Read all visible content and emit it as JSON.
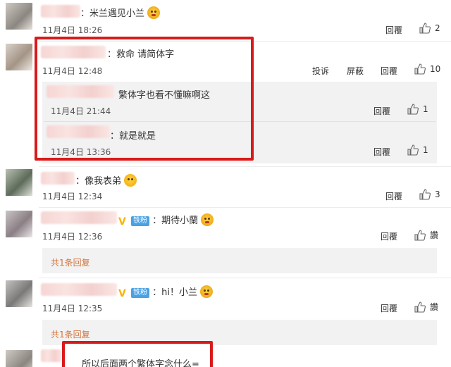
{
  "comments": [
    {
      "suffix": "：米兰遇见小兰",
      "time": "11月4日 18:26",
      "reply": "回覆",
      "likes": "2"
    },
    {
      "suffix": "：救命 请简体字",
      "time": "11月4日 12:48",
      "report": "投诉",
      "block": "屏蔽",
      "reply": "回覆",
      "likes": "10",
      "subs": [
        {
          "suffix": "繁体字也看不懂嘛啊这",
          "time": "11月4日 21:44",
          "reply": "回覆",
          "likes": "1"
        },
        {
          "suffix": "：就是就是",
          "time": "11月4日 13:36",
          "reply": "回覆",
          "likes": "1"
        }
      ]
    },
    {
      "suffix": "：像我表弟",
      "time": "11月4日 12:34",
      "reply": "回覆",
      "likes": "3"
    },
    {
      "badge": "铁粉",
      "suffix": "：期待小蘭",
      "time": "11月4日 12:36",
      "reply": "回覆",
      "likes": "讚",
      "reply_count": "共1条回复"
    },
    {
      "badge": "铁粉",
      "suffix": "：hi！小兰",
      "time": "11月4日 12:35",
      "reply": "回覆",
      "likes": "讚",
      "reply_count": "共1条回复"
    }
  ],
  "bottom_text": "所以后面两个繁体字念什么=",
  "colors": {
    "highlight": "#d91a1a",
    "reply_link": "#d4733c",
    "badge": "#4aa1e3"
  },
  "icons": {
    "like": "thumbs-up-icon",
    "vip": "vip-v-icon"
  }
}
